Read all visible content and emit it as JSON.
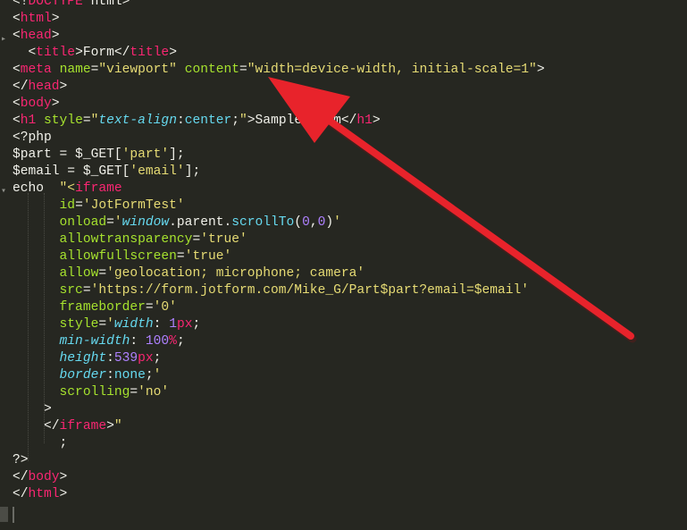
{
  "editor": {
    "colors": {
      "background": "#262721",
      "tag": "#f92672",
      "attribute": "#a6e22e",
      "string": "#e6db74",
      "property": "#66d9ef",
      "number": "#ae81ff",
      "text": "#f1f1ea"
    },
    "lines": [
      [
        [
          "x",
          "<!"
        ],
        [
          "t",
          "DOCTYPE"
        ],
        [
          "x",
          " html>"
        ]
      ],
      [
        [
          "x",
          "<"
        ],
        [
          "t",
          "html"
        ],
        [
          "x",
          ">"
        ]
      ],
      [
        [
          "x",
          "<"
        ],
        [
          "t",
          "head"
        ],
        [
          "x",
          ">"
        ]
      ],
      [
        [
          "x",
          "  <"
        ],
        [
          "t",
          "title"
        ],
        [
          "x",
          ">Form</"
        ],
        [
          "t",
          "title"
        ],
        [
          "x",
          ">"
        ]
      ],
      [
        [
          "x",
          "<"
        ],
        [
          "t",
          "meta"
        ],
        [
          "x",
          " "
        ],
        [
          "a",
          "name"
        ],
        [
          "x",
          "="
        ],
        [
          "s",
          "\"viewport\""
        ],
        [
          "x",
          " "
        ],
        [
          "a",
          "content"
        ],
        [
          "x",
          "="
        ],
        [
          "s",
          "\"width=device-width, initial-scale=1\""
        ],
        [
          "x",
          ">"
        ]
      ],
      [
        [
          "x",
          "</"
        ],
        [
          "t",
          "head"
        ],
        [
          "x",
          ">"
        ]
      ],
      [
        [
          "x",
          "<"
        ],
        [
          "t",
          "body"
        ],
        [
          "x",
          ">"
        ]
      ],
      [
        [
          "x",
          "<"
        ],
        [
          "t",
          "h1"
        ],
        [
          "x",
          " "
        ],
        [
          "a",
          "style"
        ],
        [
          "x",
          "="
        ],
        [
          "s",
          "\""
        ],
        [
          "p",
          "text-align"
        ],
        [
          "x",
          ":"
        ],
        [
          "f",
          "center"
        ],
        [
          "x",
          ";"
        ],
        [
          "s",
          "\""
        ],
        [
          "x",
          ">Sample Form</"
        ],
        [
          "t",
          "h1"
        ],
        [
          "x",
          ">"
        ]
      ],
      [
        [
          "x",
          "<?php"
        ]
      ],
      [
        [
          "x",
          "$part = $_GET["
        ],
        [
          "s",
          "'part'"
        ],
        [
          "x",
          "];"
        ]
      ],
      [
        [
          "x",
          "$email = $_GET["
        ],
        [
          "s",
          "'email'"
        ],
        [
          "x",
          "];"
        ]
      ],
      [
        [
          "x",
          "echo  "
        ],
        [
          "s",
          "\"<"
        ],
        [
          "t",
          "iframe"
        ]
      ],
      [
        [
          "x",
          "      "
        ],
        [
          "a",
          "id"
        ],
        [
          "x",
          "="
        ],
        [
          "s",
          "'JotFormTest'"
        ]
      ],
      [
        [
          "x",
          "      "
        ],
        [
          "a",
          "onload"
        ],
        [
          "x",
          "="
        ],
        [
          "s",
          "'"
        ],
        [
          "p",
          "window"
        ],
        [
          "x",
          ".parent."
        ],
        [
          "f",
          "scrollTo"
        ],
        [
          "x",
          "("
        ],
        [
          "n",
          "0"
        ],
        [
          "x",
          ","
        ],
        [
          "n",
          "0"
        ],
        [
          "x",
          ")"
        ],
        [
          "s",
          "'"
        ]
      ],
      [
        [
          "x",
          "      "
        ],
        [
          "a",
          "allowtransparency"
        ],
        [
          "x",
          "="
        ],
        [
          "s",
          "'true'"
        ]
      ],
      [
        [
          "x",
          "      "
        ],
        [
          "a",
          "allowfullscreen"
        ],
        [
          "x",
          "="
        ],
        [
          "s",
          "'true'"
        ]
      ],
      [
        [
          "x",
          "      "
        ],
        [
          "a",
          "allow"
        ],
        [
          "x",
          "="
        ],
        [
          "s",
          "'geolocation; microphone; camera'"
        ]
      ],
      [
        [
          "x",
          "      "
        ],
        [
          "a",
          "src"
        ],
        [
          "x",
          "="
        ],
        [
          "s",
          "'https://form.jotform.com/Mike_G/Part$part?email=$email'"
        ]
      ],
      [
        [
          "x",
          "      "
        ],
        [
          "a",
          "frameborder"
        ],
        [
          "x",
          "="
        ],
        [
          "s",
          "'0'"
        ]
      ],
      [
        [
          "x",
          "      "
        ],
        [
          "a",
          "style"
        ],
        [
          "x",
          "="
        ],
        [
          "s",
          "'"
        ],
        [
          "p",
          "width"
        ],
        [
          "x",
          ": "
        ],
        [
          "n",
          "1"
        ],
        [
          "t",
          "px"
        ],
        [
          "x",
          ";"
        ]
      ],
      [
        [
          "x",
          "      "
        ],
        [
          "p",
          "min-width"
        ],
        [
          "x",
          ": "
        ],
        [
          "n",
          "100"
        ],
        [
          "t",
          "%"
        ],
        [
          "x",
          ";"
        ]
      ],
      [
        [
          "x",
          "      "
        ],
        [
          "p",
          "height"
        ],
        [
          "x",
          ":"
        ],
        [
          "n",
          "539"
        ],
        [
          "t",
          "px"
        ],
        [
          "x",
          ";"
        ]
      ],
      [
        [
          "x",
          "      "
        ],
        [
          "p",
          "border"
        ],
        [
          "x",
          ":"
        ],
        [
          "f",
          "none"
        ],
        [
          "x",
          ";"
        ],
        [
          "s",
          "'"
        ]
      ],
      [
        [
          "x",
          "      "
        ],
        [
          "a",
          "scrolling"
        ],
        [
          "x",
          "="
        ],
        [
          "s",
          "'no'"
        ]
      ],
      [
        [
          "x",
          "    >"
        ]
      ],
      [
        [
          "x",
          "    </"
        ],
        [
          "t",
          "iframe"
        ],
        [
          "x",
          ">"
        ],
        [
          "s",
          "\""
        ]
      ],
      [
        [
          "x",
          "      ;"
        ]
      ],
      [
        [
          "x",
          "?>"
        ]
      ],
      [
        [
          "x",
          "</"
        ],
        [
          "t",
          "body"
        ],
        [
          "x",
          ">"
        ]
      ],
      [
        [
          "x",
          "</"
        ],
        [
          "t",
          "html"
        ],
        [
          "x",
          ">"
        ]
      ]
    ]
  },
  "annotation": {
    "type": "arrow",
    "color": "#e8232b"
  }
}
